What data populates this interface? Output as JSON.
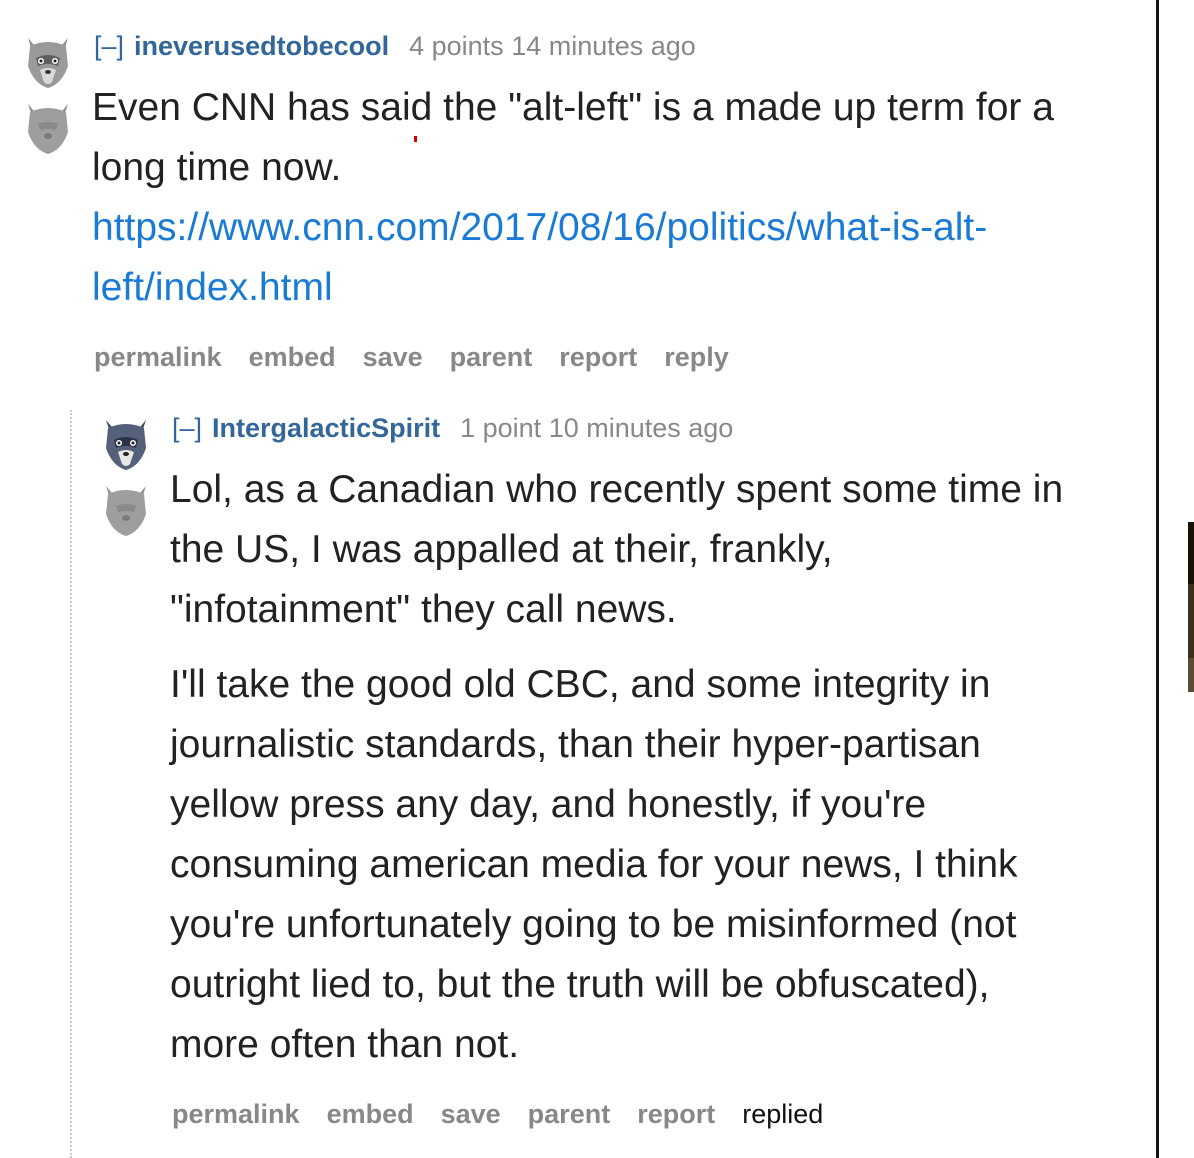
{
  "comments": [
    {
      "toggle": "[–]",
      "author": "ineverusedtobecool",
      "score": "4 points",
      "time": "14 minutes ago",
      "body_lines": [
        "Even CNN has said the \"alt-left\" is a made up term for a",
        "long time now."
      ],
      "link_lines": [
        "https://www.cnn.com/2017/08/16/politics/what-is-alt-",
        "left/index.html"
      ],
      "actions": [
        "permalink",
        "embed",
        "save",
        "parent",
        "report",
        "reply"
      ]
    },
    {
      "toggle": "[–]",
      "author": "IntergalacticSpirit",
      "score": "1 point",
      "time": "10 minutes ago",
      "paragraph1_lines": [
        "Lol, as a Canadian who recently spent some time in",
        "the US, I was appalled at their, frankly,",
        "\"infotainment\" they call news."
      ],
      "paragraph2_lines": [
        "I'll take the good old CBC, and some integrity in",
        "journalistic standards, than their hyper-partisan",
        "yellow press any day, and honestly, if you're",
        "consuming american media for your news, I think",
        "you're unfortunately going to be misinformed (not",
        "outright lied to, but the truth will be obfuscated),",
        "more often than not."
      ],
      "actions": [
        "permalink",
        "embed",
        "save",
        "parent",
        "report"
      ],
      "status": "replied"
    }
  ],
  "icons": {
    "vote_up": "wolf-upvote-icon",
    "vote_down": "wolf-downvote-icon"
  },
  "colors": {
    "author": "#336699",
    "link": "#1a7bd6",
    "muted": "#888888",
    "text": "#222222"
  }
}
